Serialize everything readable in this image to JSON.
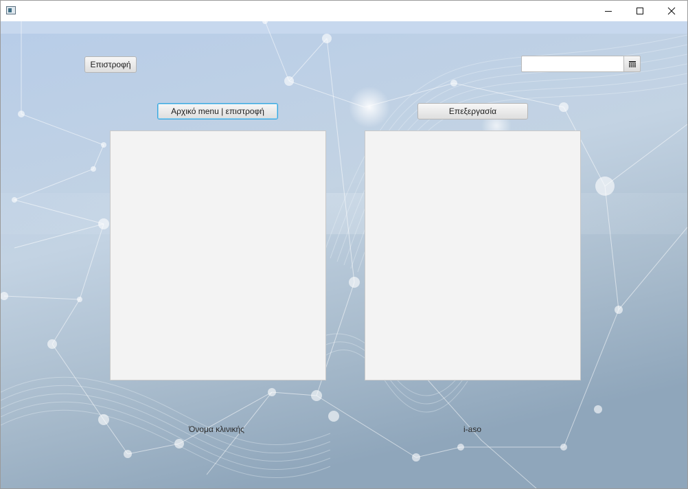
{
  "window": {
    "title": "",
    "controls": {
      "minimize": "minimize",
      "maximize": "maximize",
      "close": "close"
    }
  },
  "toolbar": {
    "back_label": "Επιστροφή",
    "main_menu_back_label": "Αρχικό menu | επιστροφή",
    "edit_label": "Επεξεργασία"
  },
  "date_picker": {
    "value": "",
    "placeholder": "",
    "icon": "calendar-icon"
  },
  "labels": {
    "clinic_name": "Όνομα κλινικής",
    "i_aso": "i-aso"
  },
  "colors": {
    "background_top": "#b9cde6",
    "background_bottom": "#8ea6c0",
    "panel": "#f3f3f3",
    "focus": "#3aa7dd"
  }
}
